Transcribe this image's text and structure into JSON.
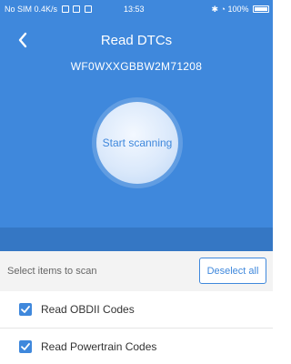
{
  "status_bar": {
    "left_text": "No SIM 0.4K/s",
    "time": "13:53",
    "battery": "100%"
  },
  "nav": {
    "title": "Read DTCs",
    "vin": "WF0WXXGBBW2M71208",
    "back_icon": "chevron-left-icon"
  },
  "scan": {
    "label": "Start scanning"
  },
  "selection": {
    "label": "Select items to scan",
    "deselect_label": "Deselect all"
  },
  "items": [
    {
      "label": "Read OBDII Codes",
      "checked": true
    },
    {
      "label": "Read Powertrain Codes",
      "checked": true
    }
  ],
  "colors": {
    "primary": "#3f88dc",
    "band": "#3577c4",
    "select_bg": "#f3f3f3"
  }
}
